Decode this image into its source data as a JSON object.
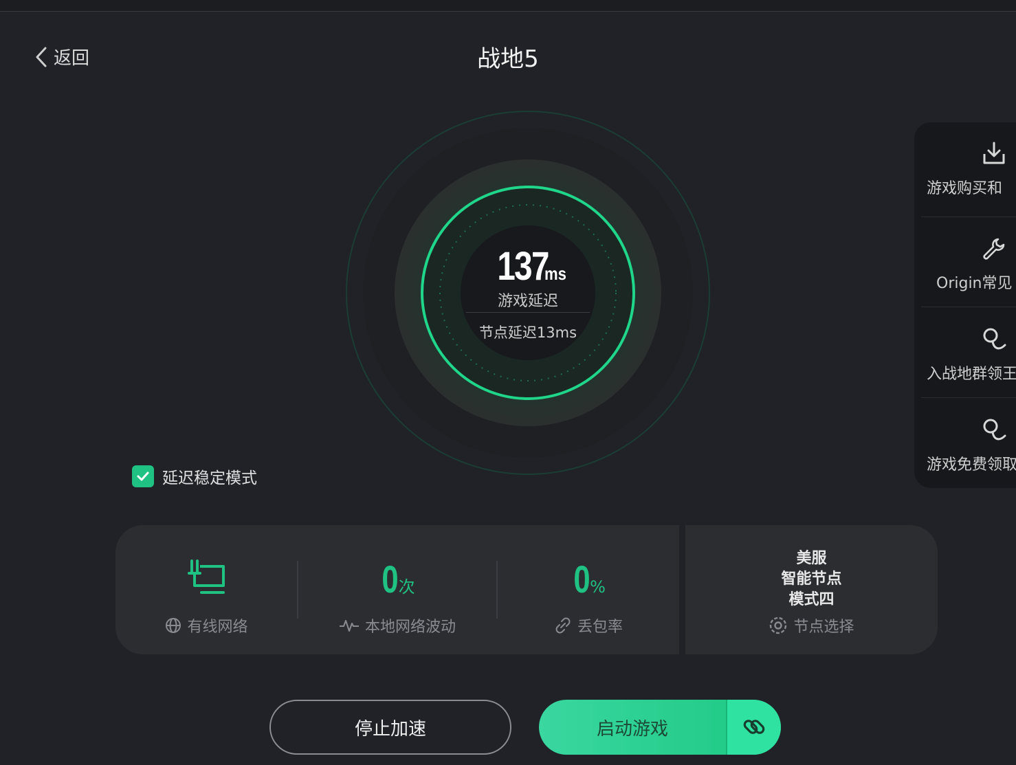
{
  "header": {
    "back_label": "返回",
    "title": "战地5"
  },
  "latency": {
    "value": "137",
    "unit": "ms",
    "label": "游戏延迟",
    "node_latency": "节点延迟13ms"
  },
  "side_panel": {
    "items": [
      {
        "label": "游戏购买和",
        "icon": "download-icon"
      },
      {
        "label": "Origin常见",
        "icon": "wrench-icon"
      },
      {
        "label": "入战地群领王",
        "icon": "gift-icon"
      },
      {
        "label": "游戏免费领取",
        "icon": "gift-icon"
      }
    ]
  },
  "stable_mode": {
    "label": "延迟稳定模式",
    "checked": true
  },
  "stats": {
    "network": {
      "label": "有线网络",
      "icon": "ethernet-icon"
    },
    "fluctuation": {
      "value": "0",
      "unit": "次",
      "label": "本地网络波动"
    },
    "packet_loss": {
      "value": "0",
      "unit": "%",
      "label": "丢包率"
    },
    "node": {
      "region": "美服",
      "name": "智能节点",
      "mode": "模式四",
      "label": "节点选择"
    }
  },
  "buttons": {
    "stop": "停止加速",
    "launch": "启动游戏"
  },
  "colors": {
    "accent": "#1fc283",
    "background": "#212227",
    "panel": "#2c2d31"
  }
}
